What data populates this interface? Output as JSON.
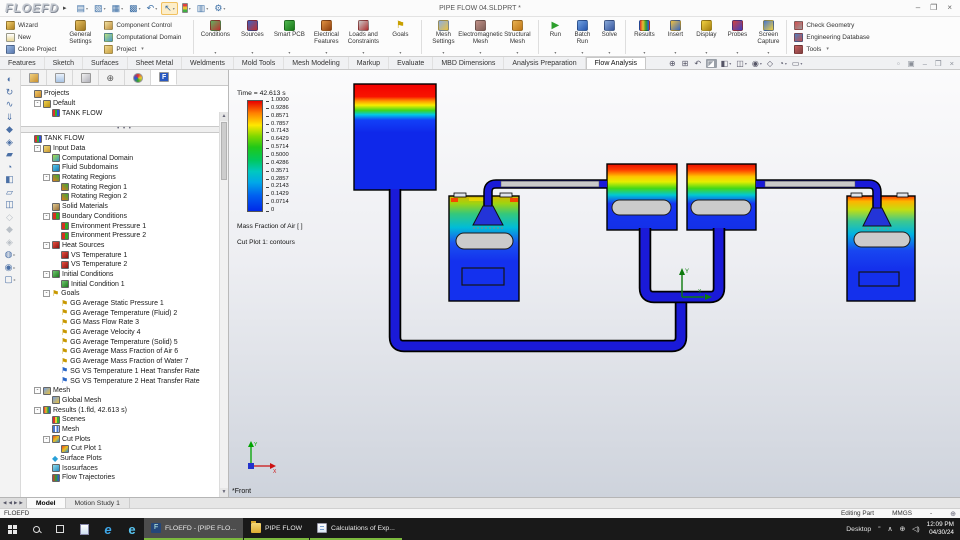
{
  "app": {
    "logo": "FLOEFD",
    "window_title": "PIPE FLOW 04.SLDPRT *",
    "status_app": "FLOEFD"
  },
  "quickbar": {
    "items": [
      {
        "name": "new-document-icon",
        "g": "▤",
        "dd": true
      },
      {
        "name": "open-icon",
        "g": "▧",
        "dd": true
      },
      {
        "name": "save-icon",
        "g": "▦",
        "dd": true
      },
      {
        "name": "print-icon",
        "g": "▩",
        "dd": true
      },
      {
        "name": "undo-icon",
        "g": "↶",
        "dd": true
      },
      {
        "name": "select-icon",
        "g": "↖",
        "dd": true,
        "pressed": true
      },
      {
        "name": "traffic-light-icon",
        "g": "",
        "tl": true
      },
      {
        "name": "table-icon",
        "g": "▥"
      },
      {
        "name": "options-gear-icon",
        "g": "⚙",
        "dd": true
      }
    ]
  },
  "ribbon": {
    "stack_left": [
      {
        "label": "Wizard",
        "icon": "wizard"
      },
      {
        "label": "New",
        "icon": "new-doc"
      },
      {
        "label": "Clone Project",
        "icon": "clone"
      }
    ],
    "general": {
      "label": "General Settings",
      "icon": "general-settings"
    },
    "stack_project": [
      {
        "label": "Component Control",
        "icon": "component-control"
      },
      {
        "label": "Computational Domain",
        "icon": "computational-domain"
      },
      {
        "label": "Project",
        "icon": "project-settings",
        "dd": "▾"
      }
    ],
    "group_flow": [
      {
        "label": "Conditions",
        "icon": "conditions"
      },
      {
        "label": "Sources",
        "icon": "sources"
      },
      {
        "label": "Smart PCB",
        "icon": "smart-pcb"
      },
      {
        "label": "Electrical Features",
        "icon": "electrical-features"
      },
      {
        "label": "Loads and Constraints",
        "icon": "loads-constraints"
      },
      {
        "label": "Goals",
        "icon": "goals",
        "glyph": "⚑"
      }
    ],
    "group_mesh": [
      {
        "label": "Mesh Settings",
        "icon": "mesh-settings"
      },
      {
        "label": "Electromagnetic Mesh",
        "icon": "em-mesh"
      },
      {
        "label": "Structural Mesh",
        "icon": "structural-mesh"
      }
    ],
    "group_run": [
      {
        "label": "Run",
        "icon": "run",
        "glyph": "▶"
      },
      {
        "label": "Batch Run",
        "icon": "batch-run"
      },
      {
        "label": "Solve",
        "icon": "solve"
      }
    ],
    "group_post": [
      {
        "label": "Results",
        "icon": "results"
      },
      {
        "label": "Insert",
        "icon": "insert"
      },
      {
        "label": "Display",
        "icon": "display"
      },
      {
        "label": "Probes",
        "icon": "probes"
      },
      {
        "label": "Screen Capture",
        "icon": "screen-capture"
      }
    ],
    "stack_right": [
      {
        "label": "Check Geometry",
        "icon": "check-geometry"
      },
      {
        "label": "Engineering Database",
        "icon": "eng-database"
      },
      {
        "label": "Tools",
        "icon": "tools",
        "dd": "▾"
      }
    ]
  },
  "doc_tabs": [
    {
      "label": "Features"
    },
    {
      "label": "Sketch"
    },
    {
      "label": "Surfaces"
    },
    {
      "label": "Sheet Metal"
    },
    {
      "label": "Weldments"
    },
    {
      "label": "Mold Tools"
    },
    {
      "label": "Mesh Modeling"
    },
    {
      "label": "Markup"
    },
    {
      "label": "Evaluate"
    },
    {
      "label": "MBD Dimensions"
    },
    {
      "label": "Analysis Preparation"
    },
    {
      "label": "Flow Analysis",
      "active": true
    }
  ],
  "headsup": [
    {
      "g": "⊕"
    },
    {
      "g": "⊞"
    },
    {
      "g": "↶"
    },
    {
      "g": "◪",
      "pressed": true
    },
    {
      "g": "◧",
      "dd": "▾"
    },
    {
      "g": "◫",
      "dd": "▾"
    },
    {
      "g": "◉",
      "dd": "▾"
    },
    {
      "g": "◇"
    },
    {
      "g": "◔",
      "dd": "▾"
    },
    {
      "g": "▭",
      "dd": "▾"
    }
  ],
  "docwin_controls": [
    {
      "g": "▫"
    },
    {
      "g": "▣"
    },
    {
      "g": "–"
    },
    {
      "g": "❐"
    },
    {
      "g": "×"
    }
  ],
  "titlebar_controls": [
    {
      "g": "–"
    },
    {
      "g": "❐"
    },
    {
      "g": "×"
    }
  ],
  "left_strip": [
    {
      "g": "◐"
    },
    {
      "g": "↻"
    },
    {
      "g": "∿"
    },
    {
      "g": "⇓"
    },
    {
      "g": "◆"
    },
    {
      "g": "◈"
    },
    {
      "g": "▰"
    },
    {
      "g": "◔"
    },
    {
      "g": "◧"
    },
    {
      "g": "▱"
    },
    {
      "g": "◫"
    },
    {
      "g": "◇",
      "muted": true,
      "sep": true
    },
    {
      "g": "◆",
      "muted": true
    },
    {
      "g": "◈",
      "muted": true
    },
    {
      "g": "◍",
      "dd": "▸",
      "sep": true
    },
    {
      "g": "◉",
      "dd": "▸"
    },
    {
      "g": "▢",
      "dd": "▸"
    }
  ],
  "panel_tabs": [
    {
      "icon": "pt-feature",
      "name": "featuremanager-tab"
    },
    {
      "icon": "pt-property",
      "name": "propertymanager-tab"
    },
    {
      "icon": "pt-config",
      "name": "configurationmanager-tab"
    },
    {
      "icon": "pt-dimxpert",
      "name": "dimxpertmanager-tab"
    },
    {
      "icon": "pt-display",
      "name": "displaymanager-tab"
    },
    {
      "icon": "pt-floefd",
      "name": "floefd-analysis-tab",
      "active": true
    }
  ],
  "upper_tree": [
    {
      "d": 0,
      "exp": "",
      "icon": "projects-folder",
      "label": "Projects"
    },
    {
      "d": 1,
      "exp": "-",
      "icon": "key",
      "label": "Default"
    },
    {
      "d": 2,
      "exp": "",
      "icon": "project",
      "label": "TANK FLOW"
    }
  ],
  "tree": [
    {
      "d": 0,
      "exp": "",
      "icon": "project",
      "label": "TANK FLOW"
    },
    {
      "d": 1,
      "exp": "-",
      "icon": "input-data",
      "label": "Input Data"
    },
    {
      "d": 2,
      "exp": "",
      "icon": "comp-domain",
      "label": "Computational Domain"
    },
    {
      "d": 2,
      "exp": "",
      "icon": "fluid-subdomains",
      "label": "Fluid Subdomains"
    },
    {
      "d": 2,
      "exp": "-",
      "icon": "rotating",
      "label": "Rotating Regions"
    },
    {
      "d": 3,
      "exp": "",
      "icon": "rotating",
      "label": "Rotating Region 1"
    },
    {
      "d": 3,
      "exp": "",
      "icon": "rotating",
      "label": "Rotating Region 2"
    },
    {
      "d": 2,
      "exp": "",
      "icon": "solid-materials",
      "label": "Solid Materials"
    },
    {
      "d": 2,
      "exp": "-",
      "icon": "boundary",
      "label": "Boundary Conditions"
    },
    {
      "d": 3,
      "exp": "",
      "icon": "boundary",
      "label": "Environment Pressure 1"
    },
    {
      "d": 3,
      "exp": "",
      "icon": "boundary",
      "label": "Environment Pressure 2"
    },
    {
      "d": 2,
      "exp": "-",
      "icon": "heat",
      "label": "Heat Sources"
    },
    {
      "d": 3,
      "exp": "",
      "icon": "heat",
      "label": "VS Temperature 1"
    },
    {
      "d": 3,
      "exp": "",
      "icon": "heat",
      "label": "VS Temperature 2"
    },
    {
      "d": 2,
      "exp": "-",
      "icon": "initial",
      "label": "Initial Conditions"
    },
    {
      "d": 3,
      "exp": "",
      "icon": "initial",
      "label": "Initial Condition 1"
    },
    {
      "d": 2,
      "exp": "-",
      "icon": "goal-flag",
      "label": "Goals"
    },
    {
      "d": 3,
      "exp": "",
      "icon": "goal-flag",
      "label": "GG Average Static Pressure 1"
    },
    {
      "d": 3,
      "exp": "",
      "icon": "goal-flag",
      "label": "GG Average Temperature (Fluid) 2"
    },
    {
      "d": 3,
      "exp": "",
      "icon": "goal-flag",
      "label": "GG Mass Flow Rate 3"
    },
    {
      "d": 3,
      "exp": "",
      "icon": "goal-flag",
      "label": "GG Average Velocity 4"
    },
    {
      "d": 3,
      "exp": "",
      "icon": "goal-flag",
      "label": "GG Average Temperature (Solid) 5"
    },
    {
      "d": 3,
      "exp": "",
      "icon": "goal-flag",
      "label": "GG Average Mass Fraction of Air 6"
    },
    {
      "d": 3,
      "exp": "",
      "icon": "goal-flag",
      "label": "GG Average Mass Fraction of Water 7"
    },
    {
      "d": 3,
      "exp": "",
      "icon": "sg-goal",
      "label": "SG VS Temperature 1 Heat Transfer Rate"
    },
    {
      "d": 3,
      "exp": "",
      "icon": "sg-goal",
      "label": "SG VS Temperature 2 Heat Transfer Rate"
    },
    {
      "d": 1,
      "exp": "-",
      "icon": "mesh",
      "label": "Mesh"
    },
    {
      "d": 2,
      "exp": "",
      "icon": "mesh",
      "label": "Global Mesh"
    },
    {
      "d": 1,
      "exp": "-",
      "icon": "results",
      "label": "Results (1.fld, 42.613 s)"
    },
    {
      "d": 2,
      "exp": "",
      "icon": "scenes",
      "label": "Scenes"
    },
    {
      "d": 2,
      "exp": "",
      "icon": "mesh2",
      "label": "Mesh"
    },
    {
      "d": 2,
      "exp": "-",
      "icon": "cut-plots",
      "label": "Cut Plots"
    },
    {
      "d": 3,
      "exp": "",
      "icon": "cut-plots",
      "label": "Cut Plot 1"
    },
    {
      "d": 2,
      "exp": "",
      "icon": "surface-plots",
      "label": "Surface Plots"
    },
    {
      "d": 2,
      "exp": "",
      "icon": "isosurfaces",
      "label": "Isosurfaces"
    },
    {
      "d": 2,
      "exp": "",
      "icon": "flow-traj",
      "label": "Flow Trajectories"
    }
  ],
  "legend": {
    "time": "Time = 42.613 s",
    "values": [
      "1.0000",
      "0.9286",
      "0.8571",
      "0.7857",
      "0.7143",
      "0.6429",
      "0.5714",
      "0.5000",
      "0.4286",
      "0.3571",
      "0.2857",
      "0.2143",
      "0.1429",
      "0.0714",
      "0"
    ],
    "caption": "Mass Fraction of Air [ ]",
    "plot_caption": "Cut Plot 1: contours"
  },
  "viewport": {
    "view_label": "*Front",
    "triad_x": "X",
    "triad_y": "Y"
  },
  "model_tabs": {
    "nav": [
      {
        "g": "◀"
      },
      {
        "g": "◀"
      },
      {
        "g": "▶"
      },
      {
        "g": "▶"
      }
    ],
    "tabs": [
      {
        "label": "Model",
        "active": true
      },
      {
        "label": "Motion Study 1"
      }
    ]
  },
  "statusbar": {
    "left": "FLOEFD",
    "mode": "Editing Part",
    "units": "MMGS",
    "dash": "-"
  },
  "taskbar": {
    "apps": [
      {
        "icon": "floefd-app",
        "label": "FLOEFD - [PIPE FLO...",
        "active": true
      },
      {
        "icon": "folder",
        "label": "PIPE FLOW"
      },
      {
        "icon": "excel-doc",
        "label": "Calculations of Exp..."
      }
    ],
    "tray": {
      "desktop": "Desktop",
      "chevrons": "”",
      "caret": "∧",
      "globe": "⊕",
      "speaker": "◁)",
      "time": "12:09 PM",
      "date": "04/30/24"
    }
  },
  "colors": {
    "accent_pipe": "#1a1ad8",
    "tank_blue": "#1330e8",
    "taskbar_underline": "#7cb93e",
    "legend_top": "#e80000",
    "legend_bottom": "#0028e8"
  }
}
